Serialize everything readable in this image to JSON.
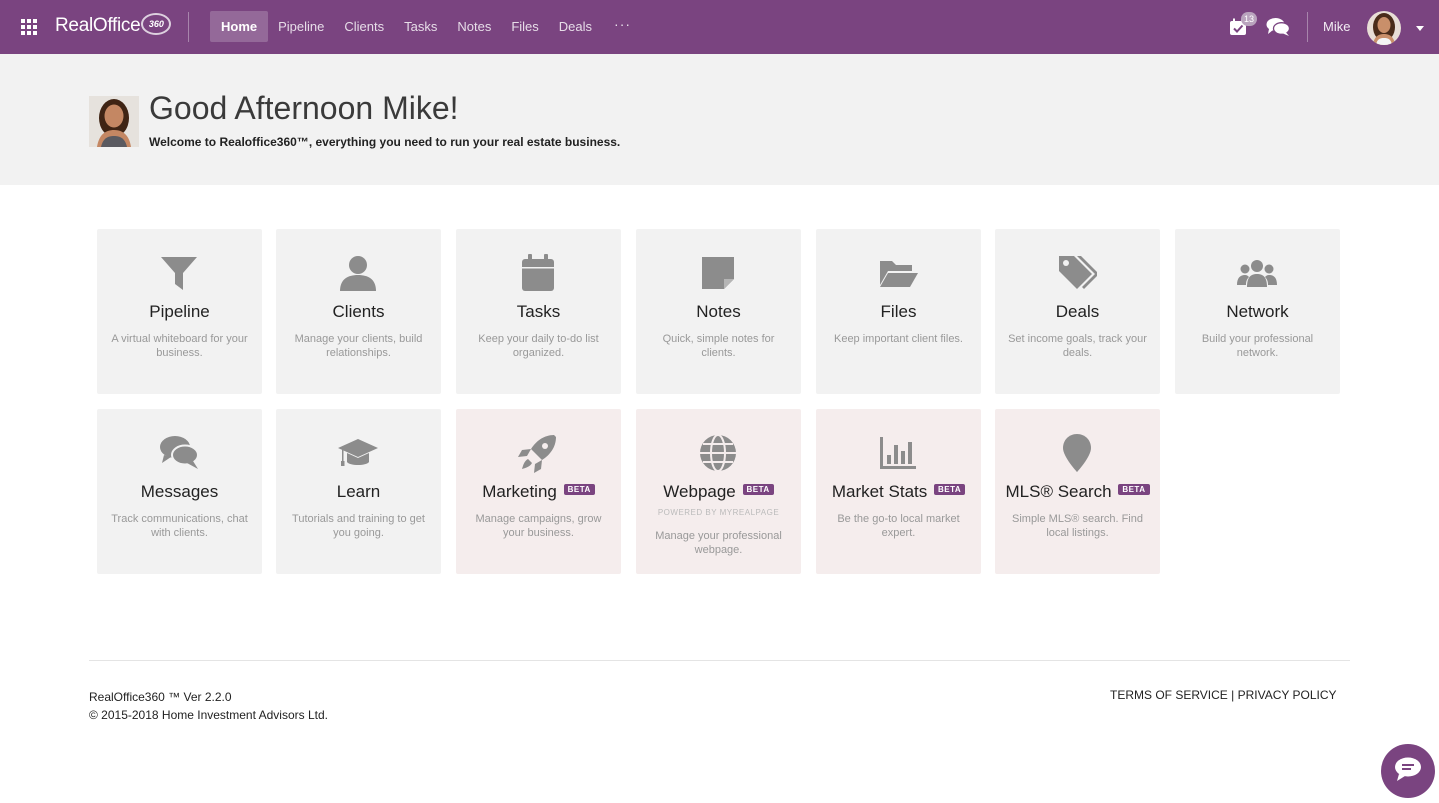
{
  "topbar": {
    "logo_text": "RealOffice",
    "logo_badge": "360",
    "nav": [
      {
        "label": "Home",
        "active": true
      },
      {
        "label": "Pipeline"
      },
      {
        "label": "Clients"
      },
      {
        "label": "Tasks"
      },
      {
        "label": "Notes"
      },
      {
        "label": "Files"
      },
      {
        "label": "Deals"
      }
    ],
    "more": "···",
    "task_badge": "13",
    "user_name": "Mike"
  },
  "greeting": {
    "title": "Good Afternoon Mike!",
    "subtitle": "Welcome to Realoffice360™, everything you need to run your real estate business."
  },
  "tiles": [
    {
      "title": "Pipeline",
      "desc": "A virtual whiteboard for your business.",
      "icon": "funnel-icon"
    },
    {
      "title": "Clients",
      "desc": "Manage your clients, build relationships.",
      "icon": "user-icon"
    },
    {
      "title": "Tasks",
      "desc": "Keep your daily to-do list organized.",
      "icon": "calendar-icon"
    },
    {
      "title": "Notes",
      "desc": "Quick, simple notes for clients.",
      "icon": "sticky-note-icon"
    },
    {
      "title": "Files",
      "desc": "Keep important client files.",
      "icon": "folder-open-icon"
    },
    {
      "title": "Deals",
      "desc": "Set income goals, track your deals.",
      "icon": "tags-icon"
    },
    {
      "title": "Network",
      "desc": "Build your professional network.",
      "icon": "users-icon"
    },
    {
      "title": "Messages",
      "desc": "Track communications, chat with clients.",
      "icon": "comments-icon"
    },
    {
      "title": "Learn",
      "desc": "Tutorials and training to get you going.",
      "icon": "graduation-cap-icon"
    },
    {
      "title": "Marketing",
      "desc": "Manage campaigns, grow your business.",
      "icon": "rocket-icon",
      "beta": "BETA"
    },
    {
      "title": "Webpage",
      "desc": "Manage your professional webpage.",
      "icon": "globe-icon",
      "beta": "BETA",
      "powered": "POWERED BY MYREALPAGE"
    },
    {
      "title": "Market Stats",
      "desc": "Be the go-to local market expert.",
      "icon": "bar-chart-icon",
      "beta": "BETA"
    },
    {
      "title": "MLS® Search",
      "desc": "Simple MLS® search. Find local listings.",
      "icon": "map-marker-icon",
      "beta": "BETA"
    }
  ],
  "footer": {
    "version": "RealOffice360 ™ Ver 2.2.0",
    "copyright": "© 2015-2018 Home Investment Advisors Ltd.",
    "terms": "TERMS OF SERVICE",
    "separator": " | ",
    "privacy": "PRIVACY POLICY"
  },
  "colors": {
    "brand": "#7a4480",
    "tile_bg": "#f2f2f2",
    "beta_tile_bg": "#f5eded",
    "icon_gray": "#8c8c8c"
  }
}
